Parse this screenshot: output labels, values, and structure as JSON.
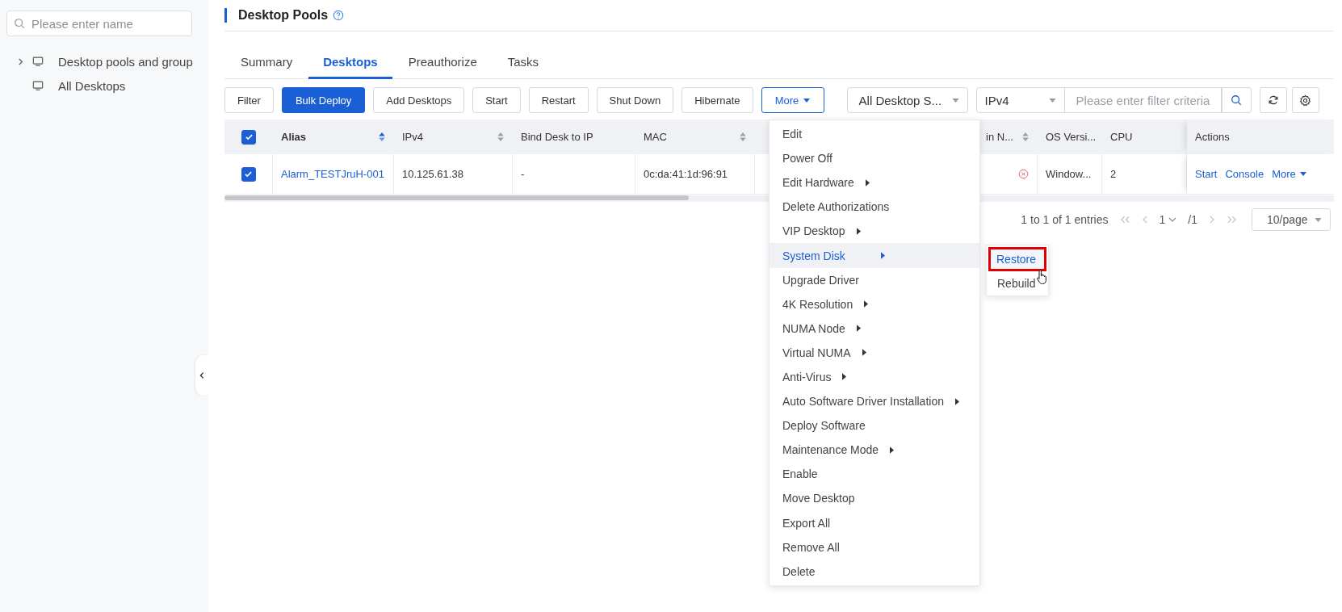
{
  "sidebar": {
    "search": {
      "placeholder": "Please enter name"
    },
    "tree": [
      {
        "label": "Desktop pools and group",
        "kind": "folder",
        "expanded": false
      },
      {
        "label": "All Desktops",
        "kind": "item"
      }
    ]
  },
  "page": {
    "title": "Desktop Pools"
  },
  "tabs": [
    {
      "label": "Summary",
      "selected": false
    },
    {
      "label": "Desktops",
      "selected": true
    },
    {
      "label": "Preauthorize",
      "selected": false
    },
    {
      "label": "Tasks",
      "selected": false
    }
  ],
  "toolbar": {
    "buttons": [
      {
        "label": "Filter",
        "kind": "default"
      },
      {
        "label": "Bulk Deploy",
        "kind": "primary"
      },
      {
        "label": "Add Desktops",
        "kind": "default"
      },
      {
        "label": "Start",
        "kind": "default"
      },
      {
        "label": "Restart",
        "kind": "default"
      },
      {
        "label": "Shut Down",
        "kind": "default"
      },
      {
        "label": "Hibernate",
        "kind": "default"
      },
      {
        "label": "More",
        "kind": "dropdown"
      }
    ],
    "status_select": {
      "value": "All Desktop S..."
    },
    "field_select": {
      "value": "IPv4"
    },
    "filter": {
      "placeholder": "Please enter filter criteria"
    }
  },
  "table": {
    "all_checked": true,
    "columns": [
      {
        "label": "Alias",
        "sortable": true,
        "sorted": true
      },
      {
        "label": "IPv4",
        "sortable": true,
        "sorted": false
      },
      {
        "label": "Bind Desk to IP",
        "sortable": false,
        "sorted": false
      },
      {
        "label": "MAC",
        "sortable": true,
        "sorted": false
      },
      {
        "label": "in N...",
        "sortable": true,
        "sorted": false
      },
      {
        "label": "OS Versi...",
        "sortable": false,
        "sorted": false
      },
      {
        "label": "CPU",
        "sortable": false,
        "sorted": false
      },
      {
        "label": "Actions",
        "sortable": false,
        "sorted": false
      }
    ],
    "rows": [
      {
        "checked": true,
        "alias": "Alarm_TESTJruH-001",
        "ipv4": "10.125.61.38",
        "bind": "-",
        "mac": "0c:da:41:1d:96:91",
        "error": true,
        "os": "Window...",
        "cpu": "2",
        "actions": [
          {
            "label": "Start",
            "kind": "link"
          },
          {
            "label": "Console",
            "kind": "link"
          },
          {
            "label": "More",
            "kind": "dropdown"
          }
        ]
      }
    ]
  },
  "pagination": {
    "summary": "1 to 1 of 1 entries",
    "page": "1",
    "total": "/1",
    "page_size": "10/page"
  },
  "menu": {
    "items": [
      {
        "label": "Edit",
        "kind": "action",
        "selected": false
      },
      {
        "label": "Power Off",
        "kind": "action",
        "selected": false
      },
      {
        "label": "Edit Hardware",
        "kind": "submenu",
        "selected": false
      },
      {
        "label": "Delete Authorizations",
        "kind": "action",
        "selected": false
      },
      {
        "label": "VIP Desktop",
        "kind": "submenu",
        "selected": false
      },
      {
        "label": "System Disk",
        "kind": "submenu",
        "selected": true
      },
      {
        "label": "Upgrade Driver",
        "kind": "action",
        "selected": false
      },
      {
        "label": "4K Resolution",
        "kind": "submenu",
        "selected": false
      },
      {
        "label": "NUMA Node",
        "kind": "submenu",
        "selected": false
      },
      {
        "label": "Virtual NUMA",
        "kind": "submenu",
        "selected": false
      },
      {
        "label": "Anti-Virus",
        "kind": "submenu",
        "selected": false
      },
      {
        "label": "Auto Software Driver Installation",
        "kind": "submenu",
        "selected": false
      },
      {
        "label": "Deploy Software",
        "kind": "action",
        "selected": false
      },
      {
        "label": "Maintenance Mode",
        "kind": "submenu",
        "selected": false
      },
      {
        "label": "Enable",
        "kind": "action",
        "selected": false
      },
      {
        "label": "Move Desktop",
        "kind": "action",
        "selected": false
      },
      {
        "label": "Export All",
        "kind": "action",
        "selected": false
      },
      {
        "label": "Remove All",
        "kind": "action",
        "selected": false
      },
      {
        "label": "Delete",
        "kind": "action",
        "selected": false
      }
    ],
    "submenu": [
      {
        "label": "Restore",
        "selected": true
      },
      {
        "label": "Rebuild",
        "selected": false
      }
    ]
  }
}
